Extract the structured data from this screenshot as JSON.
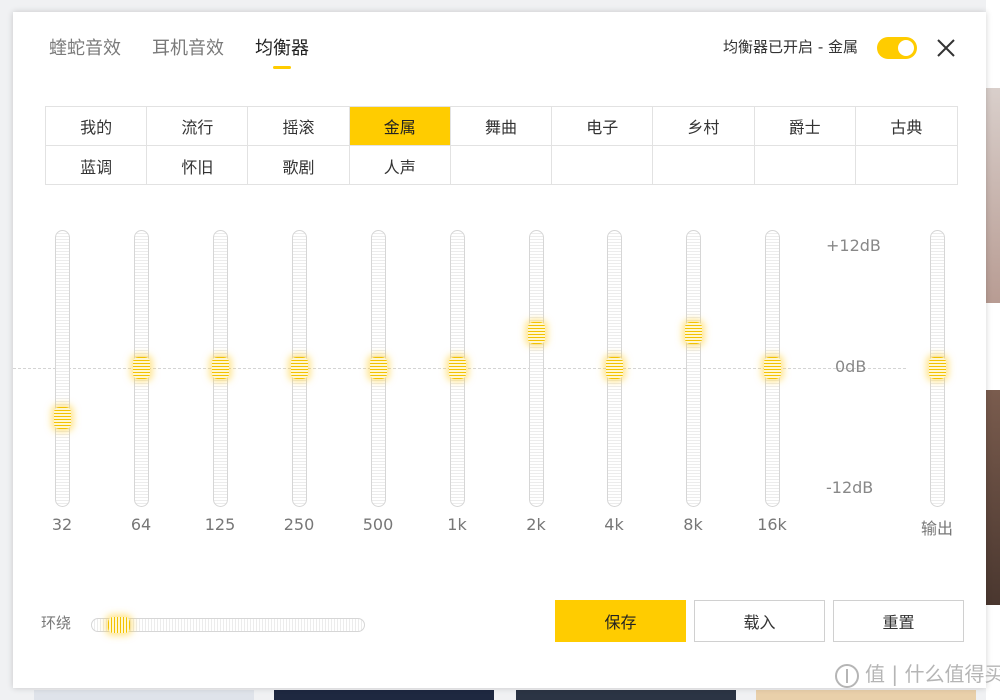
{
  "window": {
    "tabs": [
      {
        "label": "蝰蛇音效"
      },
      {
        "label": "耳机音效"
      },
      {
        "label": "均衡器"
      }
    ],
    "active_tab": "均衡器",
    "status_text": "均衡器已开启 - 金属",
    "toggle_on": true,
    "close_icon": "close-icon"
  },
  "presets": {
    "items": [
      {
        "label": "我的"
      },
      {
        "label": "流行"
      },
      {
        "label": "摇滚"
      },
      {
        "label": "金属"
      },
      {
        "label": "舞曲"
      },
      {
        "label": "电子"
      },
      {
        "label": "乡村"
      },
      {
        "label": "爵士"
      },
      {
        "label": "古典"
      },
      {
        "label": "蓝调"
      },
      {
        "label": "怀旧"
      },
      {
        "label": "歌剧"
      },
      {
        "label": "人声"
      },
      {
        "label": ""
      },
      {
        "label": ""
      },
      {
        "label": ""
      },
      {
        "label": ""
      },
      {
        "label": ""
      }
    ],
    "selected": "金属"
  },
  "eq": {
    "range_db": [
      -12,
      12
    ],
    "db_labels": {
      "top": "+12dB",
      "mid": "0dB",
      "bottom": "-12dB"
    },
    "bands": [
      {
        "freq": "32",
        "gain_db": -5
      },
      {
        "freq": "64",
        "gain_db": 0
      },
      {
        "freq": "125",
        "gain_db": 0
      },
      {
        "freq": "250",
        "gain_db": 0
      },
      {
        "freq": "500",
        "gain_db": 0
      },
      {
        "freq": "1k",
        "gain_db": 0
      },
      {
        "freq": "2k",
        "gain_db": 3.5
      },
      {
        "freq": "4k",
        "gain_db": 0
      },
      {
        "freq": "8k",
        "gain_db": 3.5
      },
      {
        "freq": "16k",
        "gain_db": 0
      }
    ],
    "output": {
      "label": "输出",
      "gain_db": 0
    }
  },
  "surround": {
    "label": "环绕",
    "level": 0.1
  },
  "buttons": {
    "save": "保存",
    "load": "载入",
    "reset": "重置"
  },
  "colors": {
    "accent": "#ffcc00"
  },
  "watermark": {
    "text": "值 | 什么值得买"
  }
}
